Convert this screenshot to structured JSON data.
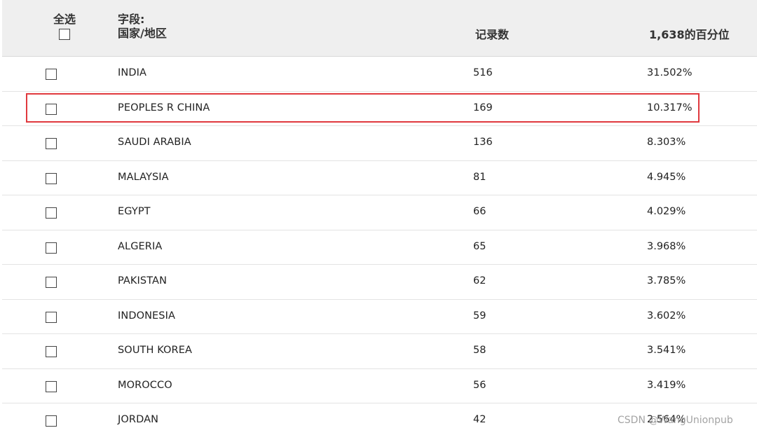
{
  "header": {
    "select_all_label": "全选",
    "field_label": "字段:",
    "field_name": "国家/地区",
    "count_label": "记录数",
    "percent_label": "1,638的百分位"
  },
  "rows": [
    {
      "country": "INDIA",
      "count": "516",
      "percent": "31.502%"
    },
    {
      "country": "PEOPLES R CHINA",
      "count": "169",
      "percent": "10.317%"
    },
    {
      "country": "SAUDI ARABIA",
      "count": "136",
      "percent": "8.303%"
    },
    {
      "country": "MALAYSIA",
      "count": "81",
      "percent": "4.945%"
    },
    {
      "country": "EGYPT",
      "count": "66",
      "percent": "4.029%"
    },
    {
      "country": "ALGERIA",
      "count": "65",
      "percent": "3.968%"
    },
    {
      "country": "PAKISTAN",
      "count": "62",
      "percent": "3.785%"
    },
    {
      "country": "INDONESIA",
      "count": "59",
      "percent": "3.602%"
    },
    {
      "country": "SOUTH KOREA",
      "count": "58",
      "percent": "3.541%"
    },
    {
      "country": "MOROCCO",
      "count": "56",
      "percent": "3.419%"
    },
    {
      "country": "JORDAN",
      "count": "42",
      "percent": "2.564%"
    }
  ],
  "highlight_color": "#e0393e",
  "watermark": "CSDN @WangUnionpub"
}
